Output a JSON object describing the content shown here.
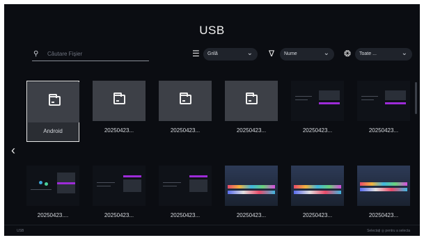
{
  "header": {
    "title": "USB"
  },
  "search": {
    "placeholder": "Căutare Fișier"
  },
  "toolbar": {
    "view": {
      "label": "Grilă"
    },
    "sort": {
      "label": "Nume"
    },
    "filter": {
      "label": "Toate ..."
    }
  },
  "grid": {
    "row1": [
      "Android",
      "20250423...",
      "20250423...",
      "20250423...",
      "20250423...",
      "20250423..."
    ],
    "row2": [
      "20250423....",
      "20250423...",
      "20250423...",
      "20250423...",
      "20250423...",
      "20250423..."
    ]
  },
  "footer": {
    "left": "USB",
    "right": "Selectați ◎ pentru a selecta"
  },
  "colors": {
    "background": "#0b0d12",
    "tile": "#3d4047",
    "accent": "#9d2bd8"
  }
}
